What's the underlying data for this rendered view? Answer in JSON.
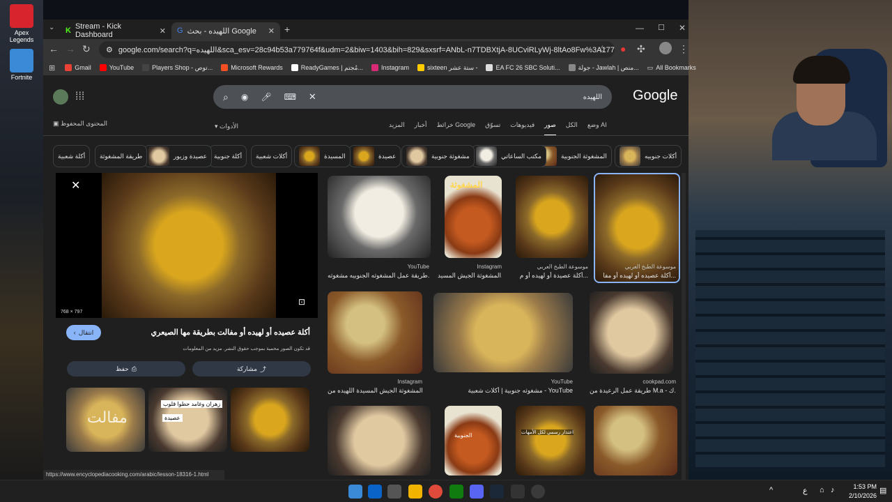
{
  "desktop": {
    "icons": [
      {
        "label": "Apex Legends"
      },
      {
        "label": "Fortnite"
      }
    ]
  },
  "tabs": [
    {
      "title": "Stream - Kick Dashboard"
    },
    {
      "title": "اللهيده - بحث Google"
    }
  ],
  "toolbar": {
    "url": "google.com/search?q=اللهيده&sca_esv=28c94b53a779764f&udm=2&biw=1403&bih=829&sxsrf=ANbL-n7TDBXtjA-8UCviRLyWj-8ltAo8Fw%3A1770720329435&ei=..."
  },
  "bookmarks": [
    {
      "label": "Gmail",
      "color": "#ea4335"
    },
    {
      "label": "YouTube",
      "color": "#ff0000"
    },
    {
      "label": "Players Shop - توص...",
      "color": "#444"
    },
    {
      "label": "Microsoft Rewards",
      "color": "#f25022"
    },
    {
      "label": "ReadyGames | مُجتم...",
      "color": "#fff"
    },
    {
      "label": "Instagram",
      "color": "#d62976"
    },
    {
      "label": "sixteen ستة عشر -",
      "color": "#ffcc00"
    },
    {
      "label": "EA FC 26 SBC Soluti...",
      "color": "#ddd"
    },
    {
      "label": "جولة - Jawlah | منص...",
      "color": "#888"
    },
    {
      "label": "All Bookmarks",
      "color": "#c4c7c5"
    }
  ],
  "google": {
    "logo": "Google",
    "query": "اللهيده",
    "saved": "المحتوى المحفوظ",
    "tools": "الأدوات",
    "tabs": [
      "وضع AI",
      "الكل",
      "صور",
      "فيديوهات",
      "تسوّق",
      "خرائط Google",
      "أخبار",
      "المزيد"
    ],
    "chips": [
      "أكلات جنوبيه",
      "المشغوثة الجنوبية",
      "مكتب الساعاتي",
      "مشغوثة جنوبية",
      "عصيدة",
      "المسيدة",
      "أكلات شعبية",
      "أكلة جنوبية",
      "عصيدة وزيور",
      "طريقة المشغوثة",
      "أكلة شعبية"
    ]
  },
  "preview": {
    "size": "768 × 797",
    "title": "أكلة عصيده أو لهيده أو مفالت بطريقة مها الصيعري",
    "copyright": "قد تكون الصور محمية بموجب حقوق النشر. مزيد من المعلومات",
    "visit": "انتقال",
    "save": "حفظ",
    "share": "مشاركة",
    "related_text_1": "مفالت",
    "related_text_2": "زهران وغامد حطوا قلوب",
    "related_text_3": "عصيدة"
  },
  "results": [
    {
      "source": "موسوعة الطبخ العربي",
      "caption": "أكلة عصيده أو لهيده أو مفا..."
    },
    {
      "source": "موسوعة الطبخ العربي",
      "caption": "أكلة عصيدة أو لهيده أو م..."
    },
    {
      "source": "Instagram",
      "caption": "المشغوثة الجيش المسيد..."
    },
    {
      "source": "YouTube",
      "caption": "طريقة عمل المشغوثه الجنوبيه مشغوثه..."
    },
    {
      "source": "cookpad.com",
      "caption": "طريقة عمل الرعيدة من M.a - ك..."
    },
    {
      "source": "YouTube",
      "caption": "مشغوثه جنوبية | أكلات شعبية - YouTube"
    },
    {
      "source": "Instagram",
      "caption": "المشغوثة الجيش المسيدة اللهيده من..."
    }
  ],
  "overlay_texts": {
    "mashghootha": "المشغوثة",
    "apology": "اعتذار رسمي لكل الأمهات",
    "janubiya": "الجنوبية"
  },
  "status_url": "https://www.encyclopediacooking.com/arabic/lesson-18316-1.html",
  "taskbar": {
    "time": "1:53 PM",
    "date": "2/10/2026",
    "lang": "ع"
  }
}
